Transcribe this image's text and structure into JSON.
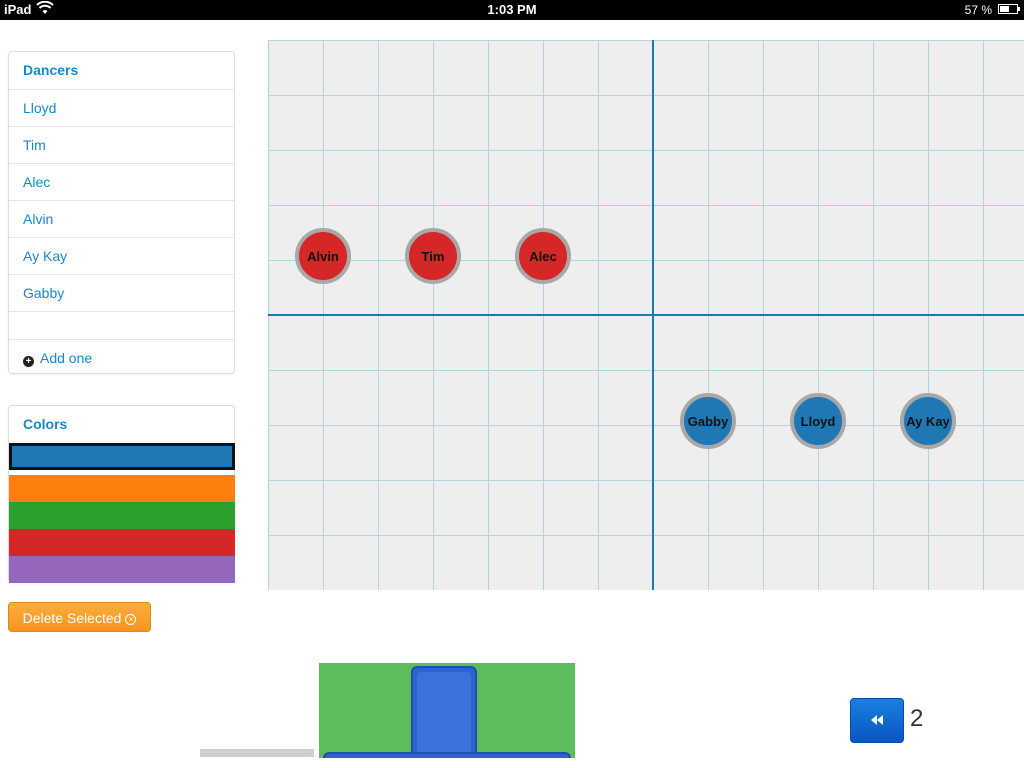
{
  "status_bar": {
    "carrier": "iPad",
    "time": "1:03 PM",
    "battery": "57 %",
    "battery_level": 0.57,
    "wifi_icon": "wifi-icon"
  },
  "dancers_panel": {
    "title": "Dancers",
    "items": [
      {
        "label": "Lloyd"
      },
      {
        "label": "Tim"
      },
      {
        "label": "Alec"
      },
      {
        "label": "Alvin"
      },
      {
        "label": "Ay Kay"
      },
      {
        "label": "Gabby"
      }
    ],
    "add_label": "Add one",
    "add_icon": "plus-circle-icon"
  },
  "colors_panel": {
    "title": "Colors",
    "swatches": [
      {
        "color": "#1f77b4",
        "selected": true
      },
      {
        "color": "#ff7f0e",
        "selected": false
      },
      {
        "color": "#2ca02c",
        "selected": false
      },
      {
        "color": "#d62728",
        "selected": false
      },
      {
        "color": "#9467bd",
        "selected": false
      }
    ]
  },
  "delete_button": {
    "label": "Delete Selected",
    "icon": "close-circle-icon"
  },
  "stage": {
    "grid_visible": true,
    "tokens": [
      {
        "name": "Alvin",
        "color": "#d62728"
      },
      {
        "name": "Tim",
        "color": "#d62728"
      },
      {
        "name": "Alec",
        "color": "#d62728"
      },
      {
        "name": "Gabby",
        "color": "#1f77b4"
      },
      {
        "name": "Lloyd",
        "color": "#1f77b4"
      },
      {
        "name": "Ay Kay",
        "color": "#1f77b4"
      }
    ]
  },
  "playback": {
    "rewind_icon": "rewind-icon",
    "page_number": "2"
  }
}
